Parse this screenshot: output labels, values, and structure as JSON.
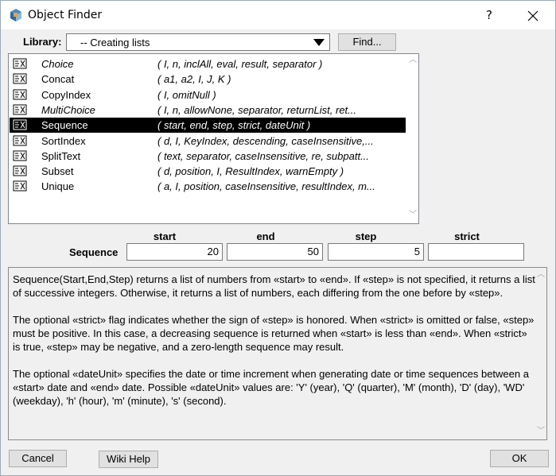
{
  "window": {
    "title": "Object Finder",
    "help": "?"
  },
  "library": {
    "label": "Library:",
    "value": "-- Creating lists",
    "find_label": "Find..."
  },
  "functions": [
    {
      "name": "Choice",
      "params": "( I, n, inclAll, eval, result, separator )",
      "italic": true,
      "selected": false
    },
    {
      "name": "Concat",
      "params": "( a1, a2, I, J, K )",
      "italic": false,
      "selected": false
    },
    {
      "name": "CopyIndex",
      "params": "( I, omitNull )",
      "italic": false,
      "selected": false
    },
    {
      "name": "MultiChoice",
      "params": "( I, n, allowNone, separator, returnList, ret...",
      "italic": true,
      "selected": false
    },
    {
      "name": "Sequence",
      "params": "( start, end, step, strict, dateUnit )",
      "italic": false,
      "selected": true
    },
    {
      "name": "SortIndex",
      "params": "( d, I, KeyIndex, descending, caseInsensitive,...",
      "italic": false,
      "selected": false
    },
    {
      "name": "SplitText",
      "params": "( text, separator, caseInsensitive, re, subpatt...",
      "italic": false,
      "selected": false
    },
    {
      "name": "Subset",
      "params": "( d, position, I, ResultIndex, warnEmpty )",
      "italic": false,
      "selected": false
    },
    {
      "name": "Unique",
      "params": "( a, I, position, caseInsensitive, resultIndex, m...",
      "italic": false,
      "selected": false
    }
  ],
  "params_panel": {
    "function_label": "Sequence",
    "headers": [
      "start",
      "end",
      "step",
      "strict"
    ],
    "values": [
      "20",
      "50",
      "5",
      ""
    ]
  },
  "description": [
    "Sequence(Start,End,Step) returns a list of numbers from «start» to «end». If «step» is not specified, it returns a list of successive integers. Otherwise, it returns a list of numbers, each differing from the one before by «step».",
    "The optional «strict» flag indicates whether the sign of «step» is honored. When «strict» is omitted or false, «step» must be positive. In this case, a decreasing sequence is returned when «start» is less than «end». When «strict» is true, «step» may be negative, and a zero-length sequence may result.",
    "The optional «dateUnit» specifies the date or time increment when generating date or time sequences between a «start» date and «end» date. Possible «dateUnit» values are: 'Y' (year), 'Q' (quarter), 'M' (month), 'D' (day), 'WD' (weekday), 'h' (hour), 'm' (minute), 's' (second)."
  ],
  "buttons": {
    "cancel": "Cancel",
    "wiki_help": "Wiki Help",
    "ok": "OK"
  },
  "icons": {
    "app": "analytica-icon",
    "function": "function-icon"
  }
}
